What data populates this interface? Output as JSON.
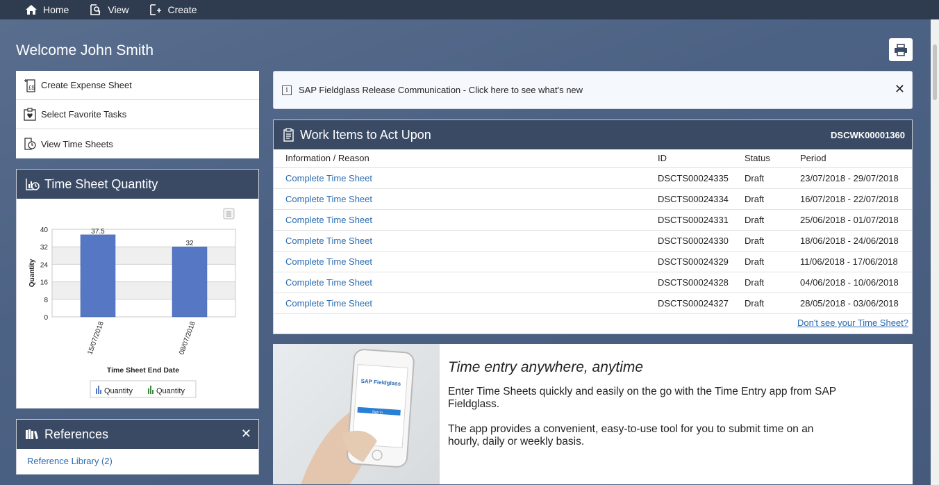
{
  "nav": [
    {
      "label": "Home",
      "icon": "home-icon"
    },
    {
      "label": "View",
      "icon": "view-icon"
    },
    {
      "label": "Create",
      "icon": "create-icon"
    }
  ],
  "welcome": "Welcome John Smith",
  "quick_links": [
    {
      "label": "Create Expense Sheet",
      "icon": "expense-sheet-icon"
    },
    {
      "label": "Select Favorite Tasks",
      "icon": "favorite-tasks-icon"
    },
    {
      "label": "View Time Sheets",
      "icon": "time-sheets-icon"
    }
  ],
  "release": {
    "text": "SAP Fieldglass Release Communication - Click here to see what's new",
    "close": "✕"
  },
  "time_sheet_quantity": {
    "title": "Time Sheet Quantity",
    "legend": [
      "Quantity",
      "Quantity"
    ]
  },
  "chart_data": {
    "type": "bar",
    "categories": [
      "15/07/2018",
      "08/07/2018"
    ],
    "values": [
      37.5,
      32
    ],
    "data_labels": [
      "37.5",
      "32"
    ],
    "xlabel": "Time Sheet End Date",
    "ylabel": "Quantity",
    "ylim": [
      0,
      40
    ],
    "yticks": [
      "0",
      "8",
      "16",
      "24",
      "32",
      "40"
    ],
    "grid": true,
    "bar_color": "#5577c4"
  },
  "references": {
    "title": "References",
    "close": "✕",
    "link": "Reference Library (2)"
  },
  "work_items": {
    "title": "Work Items to Act Upon",
    "id": "DSCWK00001360",
    "columns": [
      "Information / Reason",
      "ID",
      "Status",
      "Period"
    ],
    "rows": [
      {
        "reason": "Complete Time Sheet",
        "id": "DSCTS00024335",
        "status": "Draft",
        "period": "23/07/2018 - 29/07/2018"
      },
      {
        "reason": "Complete Time Sheet",
        "id": "DSCTS00024334",
        "status": "Draft",
        "period": "16/07/2018 - 22/07/2018"
      },
      {
        "reason": "Complete Time Sheet",
        "id": "DSCTS00024331",
        "status": "Draft",
        "period": "25/06/2018 - 01/07/2018"
      },
      {
        "reason": "Complete Time Sheet",
        "id": "DSCTS00024330",
        "status": "Draft",
        "period": "18/06/2018 - 24/06/2018"
      },
      {
        "reason": "Complete Time Sheet",
        "id": "DSCTS00024329",
        "status": "Draft",
        "period": "11/06/2018 - 17/06/2018"
      },
      {
        "reason": "Complete Time Sheet",
        "id": "DSCTS00024328",
        "status": "Draft",
        "period": "04/06/2018 - 10/06/2018"
      },
      {
        "reason": "Complete Time Sheet",
        "id": "DSCTS00024327",
        "status": "Draft",
        "period": "28/05/2018 - 03/06/2018"
      }
    ],
    "dont_see": "Don't see your Time Sheet?"
  },
  "promo": {
    "title": "Time entry anywhere, anytime",
    "p1": "Enter Time Sheets quickly and easily on the go with the Time Entry app from SAP Fieldglass.",
    "p2": "The app provides a convenient, easy-to-use tool for you to submit time on an hourly, daily or weekly basis.",
    "phone_brand": "SAP Fieldglass",
    "phone_button": "Sign in"
  },
  "colors": {
    "header": "#3a4a64",
    "topbar": "#2f3b4f",
    "link": "#2a6bb0",
    "bar": "#5577c4",
    "legend_green": "#3b8a3b"
  }
}
